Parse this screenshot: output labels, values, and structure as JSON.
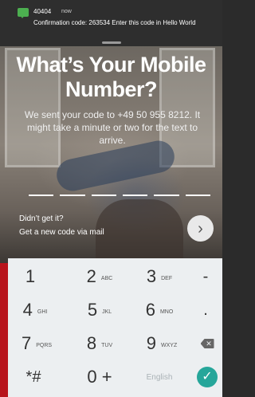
{
  "notification": {
    "sender": "40404",
    "time": "now",
    "message": "Confirmation code: 263534 Enter this code in Hello World"
  },
  "screen": {
    "title": "What’s Your Mobile Number?",
    "subtitle": "We sent your code to +49 50 955 8212. It might take a minute or two for the text to arrive.",
    "didnt_get": "Didn’t get it?",
    "new_code": "Get a new code via mail",
    "next_glyph": "›"
  },
  "keyboard": {
    "keys": [
      {
        "digit": "1",
        "letters": ""
      },
      {
        "digit": "2",
        "letters": "ABC"
      },
      {
        "digit": "3",
        "letters": "DEF"
      },
      {
        "digit": "-",
        "letters": ""
      },
      {
        "digit": "4",
        "letters": "GHI"
      },
      {
        "digit": "5",
        "letters": "JKL"
      },
      {
        "digit": "6",
        "letters": "MNO"
      },
      {
        "digit": ".",
        "letters": ""
      },
      {
        "digit": "7",
        "letters": "PQRS"
      },
      {
        "digit": "8",
        "letters": "TUV"
      },
      {
        "digit": "9",
        "letters": "WXYZ"
      }
    ],
    "star_hash": "*#",
    "zero_plus": "0 +",
    "language": "English",
    "backspace_glyph": "✕",
    "done_glyph": "✓"
  },
  "colors": {
    "accent": "#26a69a",
    "brand_red": "#b8141c"
  }
}
